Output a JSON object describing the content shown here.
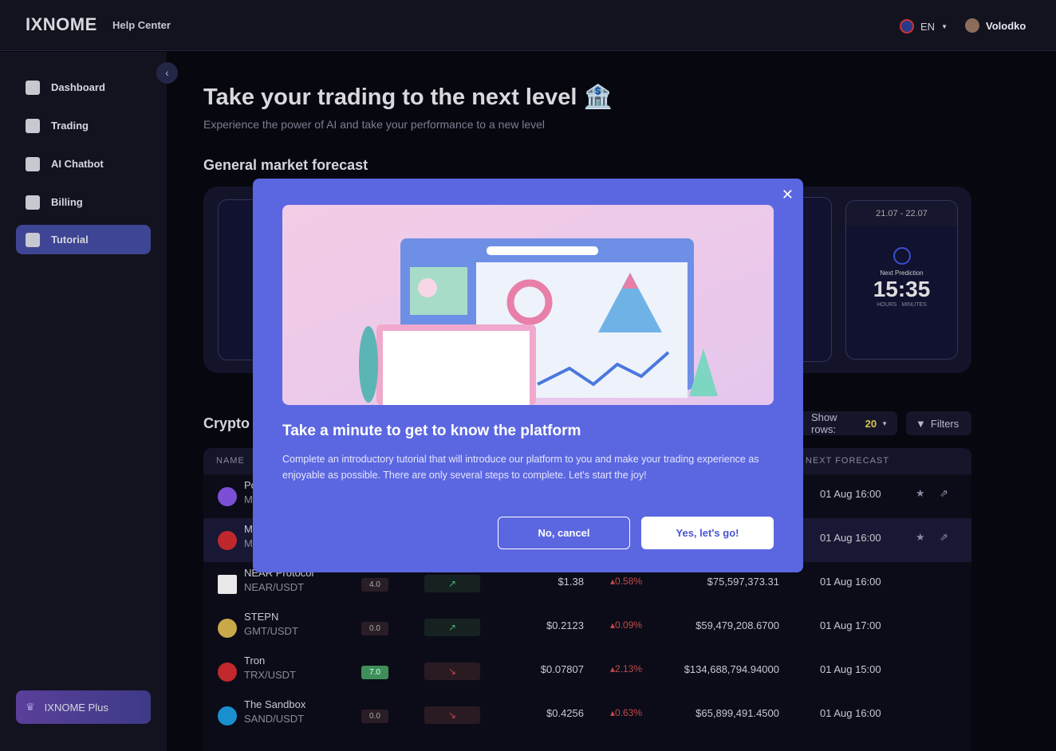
{
  "header": {
    "logo": "IXNOME",
    "help": "Help Center",
    "lang": "EN",
    "user": "Volodko"
  },
  "sidebar": {
    "items": [
      {
        "label": "Dashboard",
        "icon": "dashboard-icon"
      },
      {
        "label": "Trading",
        "icon": "chart-icon"
      },
      {
        "label": "AI Chatbot",
        "icon": "chat-icon"
      },
      {
        "label": "Billing",
        "icon": "billing-icon"
      },
      {
        "label": "Tutorial",
        "icon": "tutorial-icon",
        "active": true
      }
    ],
    "plus": "IXNOME Plus"
  },
  "main": {
    "title": "Take your trading to the next level",
    "subtitle": "Experience the power of AI and take your performance to a new level",
    "forecast_title": "General market forecast",
    "prediction": {
      "date": "21.07 - 22.07",
      "label": "Next Prediction",
      "time": "15:35",
      "hours": "HOURS",
      "minutes": "MINUTES"
    },
    "crypto_title": "Crypto",
    "show_rows_label": "Show rows:",
    "show_rows_value": "20",
    "filters": "Filters"
  },
  "table": {
    "col_name": "NAME",
    "col_forecast": "NEXT FORECAST",
    "rows": [
      {
        "name": "Po",
        "pair": "M",
        "forecast": "01 Aug 16:00"
      },
      {
        "name": "M",
        "pair": "M",
        "forecast": "01 Aug 16:00"
      },
      {
        "name": "NEAR Protocol",
        "pair": "NEAR/USDT",
        "score": "4.0",
        "trend": "up",
        "price": "$1.38",
        "change": "0.58%",
        "volume": "$75,597,373.31",
        "forecast": "01 Aug 16:00"
      },
      {
        "name": "STEPN",
        "pair": "GMT/USDT",
        "score": "0.0",
        "trend": "up",
        "price": "$0.2123",
        "change": "0.09%",
        "volume": "$59,479,208.6700",
        "forecast": "01 Aug 17:00"
      },
      {
        "name": "Tron",
        "pair": "TRX/USDT",
        "score": "7.0",
        "trend": "down",
        "price": "$0.07807",
        "change": "2.13%",
        "volume": "$134,688,794.94000",
        "forecast": "01 Aug 15:00"
      },
      {
        "name": "The Sandbox",
        "pair": "SAND/USDT",
        "score": "0.0",
        "trend": "down",
        "price": "$0.4256",
        "change": "0.63%",
        "volume": "$65,899,491.4500",
        "forecast": "01 Aug 16:00"
      }
    ]
  },
  "modal": {
    "title": "Take a minute to get to know the platform",
    "text": "Complete an introductory tutorial that will introduce our platform to you and make your trading experience as enjoyable as possible. There are only several steps to complete. Let's start the joy!",
    "cancel": "No, cancel",
    "confirm": "Yes, let's go!"
  },
  "colors": {
    "accent": "#5b67e0",
    "active_nav": "#3d4594",
    "negative": "#c24a4a",
    "positive": "#4caf6a"
  }
}
